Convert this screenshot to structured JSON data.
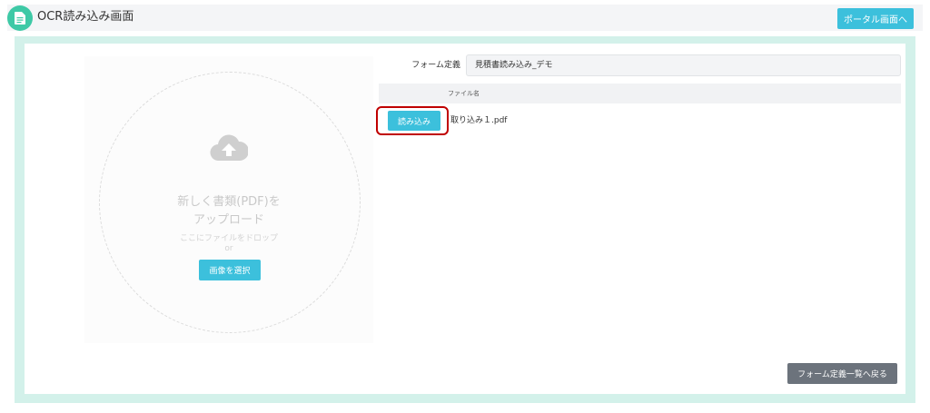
{
  "header": {
    "title": "OCR読み込み画面",
    "icon": "document-icon",
    "portal_button": "ポータル画面へ"
  },
  "upload": {
    "icon": "cloud-upload-icon",
    "title_line1": "新しく書類(PDF)を",
    "title_line2": "アップロード",
    "hint": "ここにファイルをドロップ",
    "or": "or",
    "select_button": "画像を選択"
  },
  "form": {
    "label": "フォーム定義",
    "selected_value": "見積書読み込み_デモ"
  },
  "table": {
    "columns": [
      "ファイル名"
    ],
    "rows": [
      {
        "action_label": "読み込み",
        "file_name": "取り込み１.pdf"
      }
    ]
  },
  "footer": {
    "back_button": "フォーム定義一覧へ戻る"
  },
  "colors": {
    "accent": "#3cc0dc",
    "header_icon": "#3ec9a6",
    "panel_border": "#d3f1ea",
    "back_button": "#6c737c",
    "highlight": "#c00000"
  }
}
